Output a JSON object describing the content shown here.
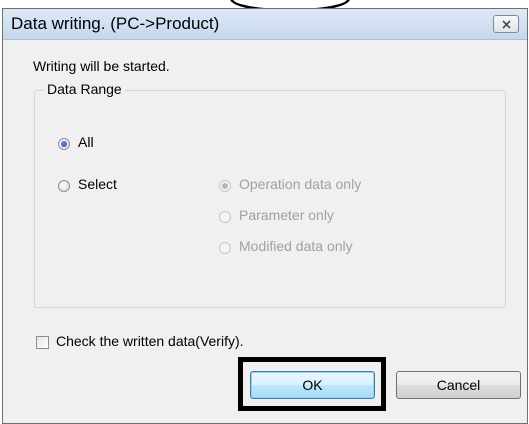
{
  "window": {
    "title": "Data writing. (PC->Product)",
    "close_icon": "close-icon"
  },
  "message": "Writing will be started.",
  "data_range": {
    "legend": "Data Range",
    "options": [
      {
        "label": "All",
        "selected": true,
        "enabled": true
      },
      {
        "label": "Select",
        "selected": false,
        "enabled": true
      }
    ],
    "sub_options": [
      {
        "label": "Operation data only",
        "selected": true,
        "enabled": false
      },
      {
        "label": "Parameter only",
        "selected": false,
        "enabled": false
      },
      {
        "label": "Modified data only",
        "selected": false,
        "enabled": false
      }
    ]
  },
  "verify": {
    "label": "Check the written data(Verify).",
    "checked": false
  },
  "buttons": {
    "ok": "OK",
    "cancel": "Cancel"
  }
}
